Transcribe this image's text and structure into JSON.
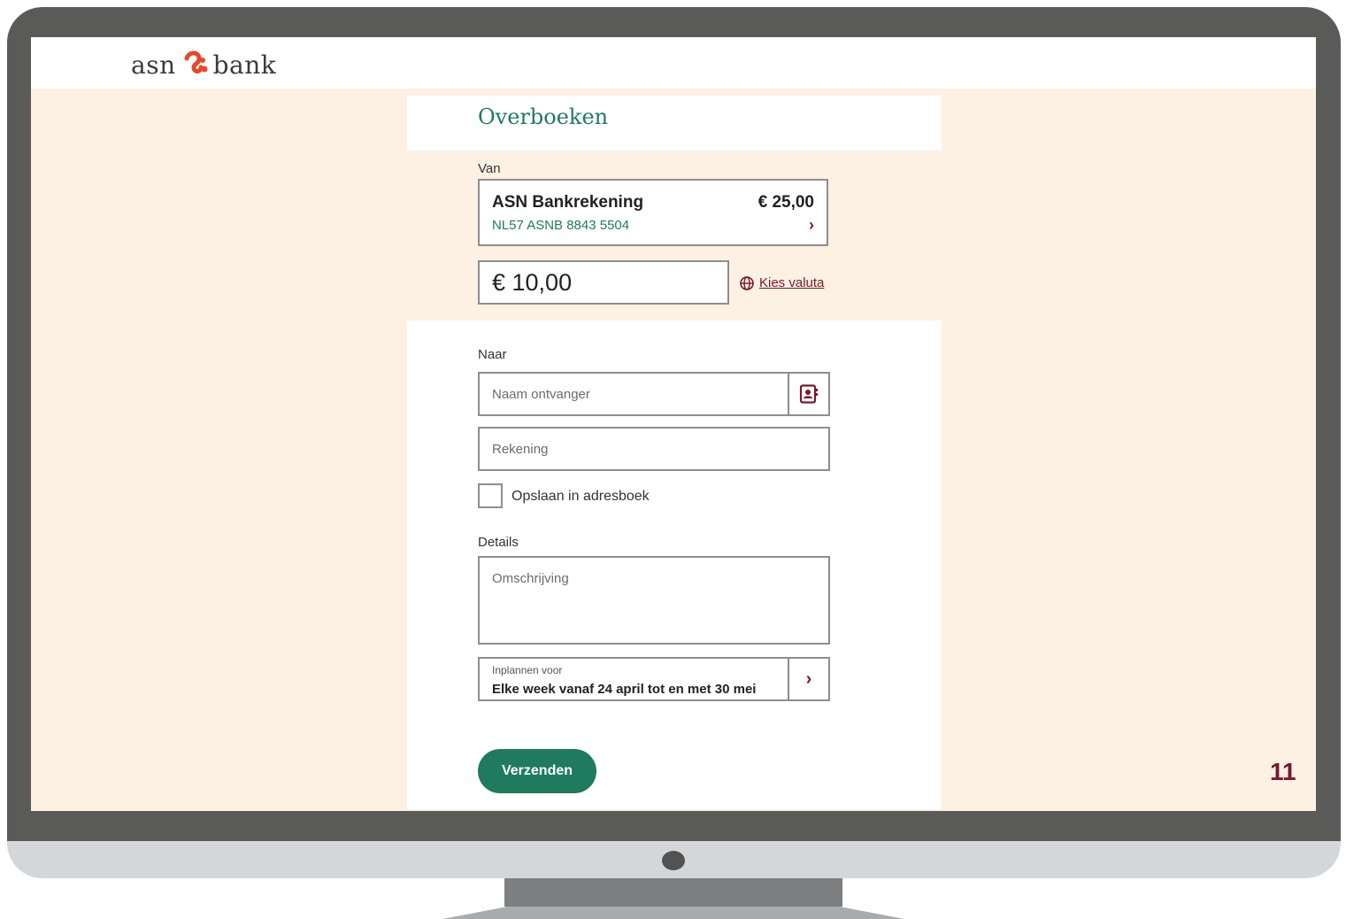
{
  "brand": {
    "logo_left": "asn",
    "logo_right": "bank",
    "accent": "#1f7a5e",
    "secondary": "#7a1731",
    "logo_color": "#e8472a"
  },
  "page": {
    "title": "Overboeken",
    "page_number": "11"
  },
  "from": {
    "label": "Van",
    "account_name": "ASN Bankrekening",
    "iban": "NL57 ASNB 8843 5504",
    "balance": "€ 25,00",
    "chevron": "›"
  },
  "amount": {
    "value": "€ 10,00",
    "currency_link": "Kies valuta",
    "currency_icon": "globe-icon"
  },
  "to": {
    "label": "Naar",
    "name_placeholder": "Naam ontvanger",
    "account_placeholder": "Rekening",
    "contacts_icon": "address-book-icon",
    "save_label": "Opslaan in adresboek"
  },
  "details": {
    "label": "Details",
    "description_placeholder": "Omschrijving",
    "schedule_label": "Inplannen voor",
    "schedule_value": "Elke week vanaf 24 april tot en met 30 mei",
    "schedule_chevron": "›"
  },
  "submit": {
    "label": "Verzenden"
  }
}
